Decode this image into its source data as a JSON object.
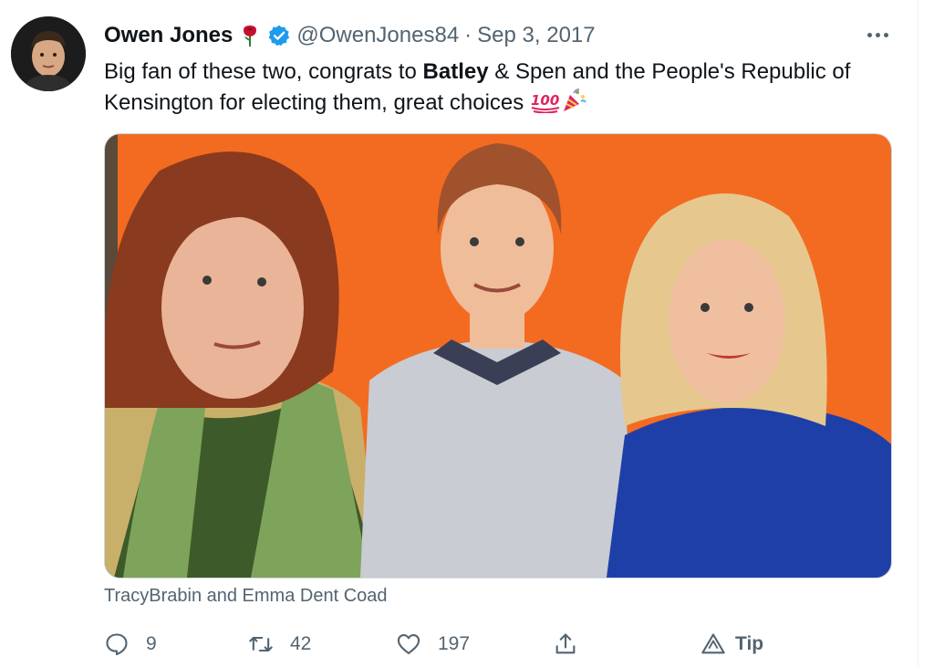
{
  "tweet": {
    "author_name": "Owen Jones",
    "handle": "@OwenJones84",
    "separator": "·",
    "date": "Sep 3, 2017",
    "text_part1": "Big fan of these two, congrats to ",
    "text_bold": "Batley",
    "text_part2": " & Spen and the People's Republic of Kensington for electing them, great choices ",
    "tagged": "TracyBrabin and Emma Dent Coad"
  },
  "actions": {
    "reply_count": "9",
    "retweet_count": "42",
    "like_count": "197",
    "tip_label": "Tip"
  },
  "colors": {
    "verified": "#1d9bf0",
    "icon_gray": "#536471",
    "rose": "#c8102e",
    "photo_background": "#f36b21"
  },
  "icons": {
    "rose": "rose-emoji",
    "verified": "verified-badge",
    "more": "more-horizontal-icon",
    "hundred": "hundred-points-emoji",
    "party": "party-popper-emoji",
    "reply": "reply-icon",
    "retweet": "retweet-icon",
    "like": "heart-icon",
    "share": "share-icon",
    "tip": "tip-icon"
  }
}
